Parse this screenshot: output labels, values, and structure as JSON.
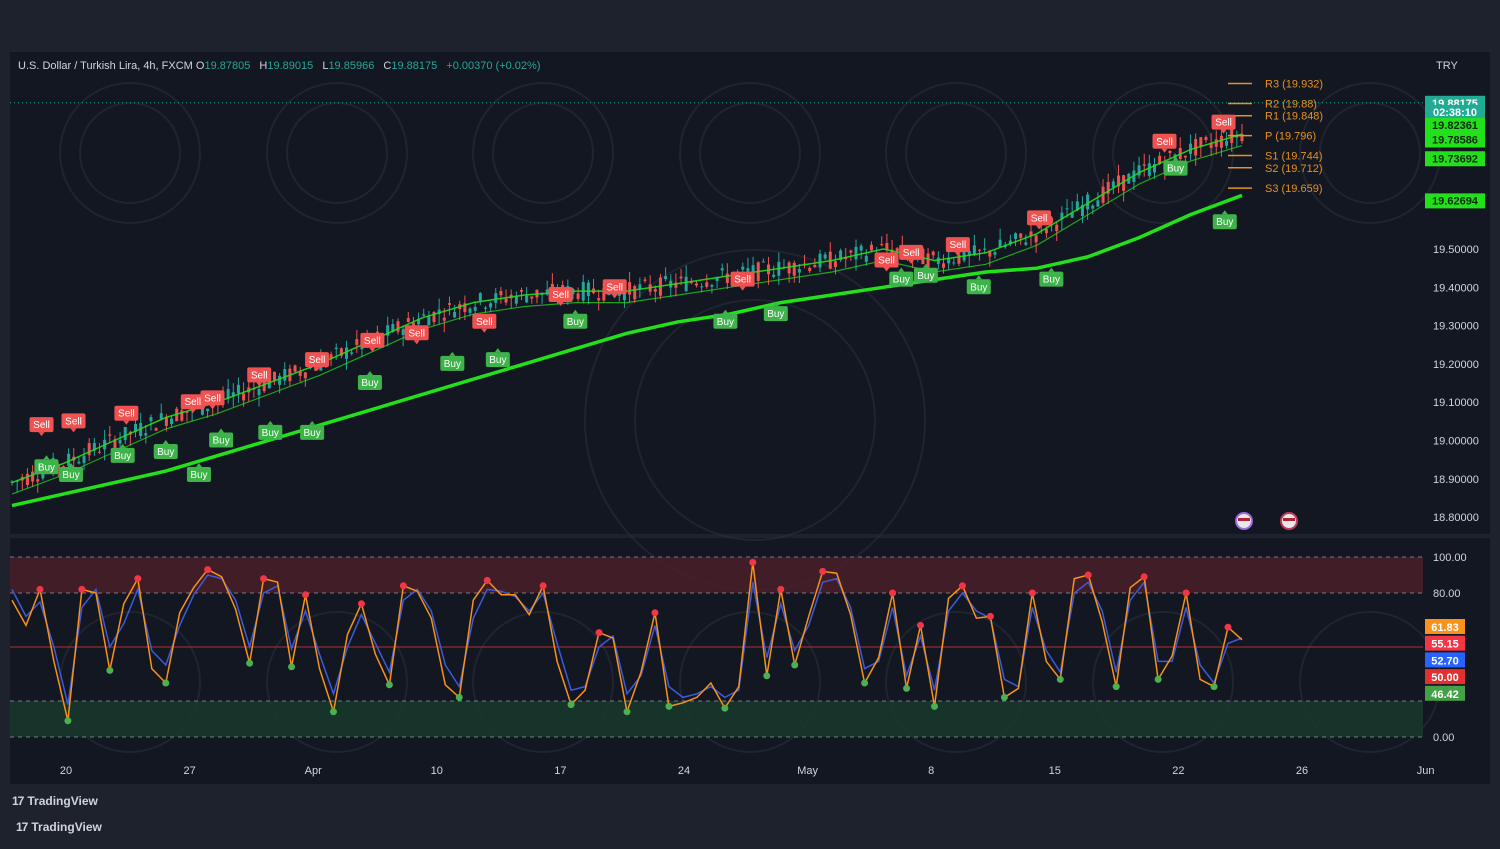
{
  "header": {
    "symbol": "U.S. Dollar / Turkish Lira, 4h, FXCM",
    "open_label": "O",
    "open": "19.87805",
    "high_label": "H",
    "high": "19.89015",
    "low_label": "L",
    "low": "19.85966",
    "close_label": "C",
    "close": "19.88175",
    "change": "+0.00370 (+0.02%)",
    "currency": "TRY"
  },
  "footer": {
    "brand1": "TradingView",
    "brand2": "TradingView"
  },
  "colors": {
    "bg": "#1e222d",
    "panel": "#131722",
    "up": "#26a69a",
    "down": "#ef5350",
    "ma": "#22e01a",
    "pivot": "#e8911b",
    "k": "#f7931a",
    "d": "#3b5bdb",
    "sell": "#f05252",
    "buy": "#3db34a"
  },
  "chart_data": [
    {
      "type": "line",
      "title": "U.S. Dollar / Turkish Lira, 4h, FXCM",
      "x_tick_labels": [
        "20",
        "27",
        "Apr",
        "10",
        "17",
        "24",
        "May",
        "8",
        "15",
        "22",
        "26",
        "Jun"
      ],
      "y_tick_labels": [
        "19.50000",
        "19.40000",
        "19.30000",
        "19.20000",
        "19.10000",
        "19.00000",
        "18.90000",
        "18.80000"
      ],
      "ylim": [
        18.77,
        20.0
      ],
      "grid": false,
      "series": [
        {
          "values": [
            18.83,
            18.86,
            18.89,
            18.92,
            18.96,
            19.0,
            19.04,
            19.08,
            19.12,
            19.16,
            19.2,
            19.24,
            19.28,
            19.31,
            19.33,
            19.36,
            19.38,
            19.4,
            19.42,
            19.44,
            19.45,
            19.48,
            19.53,
            19.59,
            19.64
          ]
        },
        {
          "values": [
            18.89,
            18.94,
            19.0,
            19.06,
            19.1,
            19.15,
            19.2,
            19.26,
            19.32,
            19.36,
            19.38,
            19.39,
            19.39,
            19.41,
            19.43,
            19.45,
            19.47,
            19.5,
            19.47,
            19.49,
            19.54,
            19.62,
            19.7,
            19.76,
            19.8
          ]
        }
      ],
      "pivots": [
        {
          "label": "R3 (19.932)",
          "value": 19.932
        },
        {
          "label": "R2 (19.88)",
          "value": 19.88
        },
        {
          "label": "R1 (19.848)",
          "value": 19.848
        },
        {
          "label": "P (19.796)",
          "value": 19.796
        },
        {
          "label": "S1 (19.744)",
          "value": 19.744
        },
        {
          "label": "S2 (19.712)",
          "value": 19.712
        },
        {
          "label": "S3 (19.659)",
          "value": 19.659
        }
      ],
      "price_badges": [
        {
          "text": "19.88175",
          "value": 19.88175,
          "color": "#22ab94"
        },
        {
          "text": "02:38:10",
          "value": 19.858,
          "color": "#22ab94"
        },
        {
          "text": "19.82361",
          "value": 19.82361,
          "color": "#22e01a"
        },
        {
          "text": "19.78586",
          "value": 19.78586,
          "color": "#22e01a"
        },
        {
          "text": "19.73692",
          "value": 19.73692,
          "color": "#22e01a"
        },
        {
          "text": "19.62694",
          "value": 19.62694,
          "color": "#22e01a"
        }
      ],
      "signals": [
        {
          "label": "Sell",
          "x": 0.024,
          "value": 19.04
        },
        {
          "label": "Sell",
          "x": 0.05,
          "value": 19.05
        },
        {
          "label": "Sell",
          "x": 0.093,
          "value": 19.07
        },
        {
          "label": "Sell",
          "x": 0.147,
          "value": 19.1
        },
        {
          "label": "Sell",
          "x": 0.163,
          "value": 19.11
        },
        {
          "label": "Sell",
          "x": 0.201,
          "value": 19.17
        },
        {
          "label": "Sell",
          "x": 0.248,
          "value": 19.21
        },
        {
          "label": "Sell",
          "x": 0.293,
          "value": 19.26
        },
        {
          "label": "Sell",
          "x": 0.329,
          "value": 19.28
        },
        {
          "label": "Sell",
          "x": 0.384,
          "value": 19.31
        },
        {
          "label": "Sell",
          "x": 0.446,
          "value": 19.38
        },
        {
          "label": "Sell",
          "x": 0.49,
          "value": 19.4
        },
        {
          "label": "Sell",
          "x": 0.594,
          "value": 19.42
        },
        {
          "label": "Sell",
          "x": 0.711,
          "value": 19.47
        },
        {
          "label": "Sell",
          "x": 0.731,
          "value": 19.49
        },
        {
          "label": "Sell",
          "x": 0.769,
          "value": 19.51
        },
        {
          "label": "Sell",
          "x": 0.835,
          "value": 19.58
        },
        {
          "label": "Sell",
          "x": 0.937,
          "value": 19.78
        },
        {
          "label": "Sell",
          "x": 0.985,
          "value": 19.83
        },
        {
          "label": "Buy",
          "x": 0.028,
          "value": 18.93
        },
        {
          "label": "Buy",
          "x": 0.048,
          "value": 18.91
        },
        {
          "label": "Buy",
          "x": 0.09,
          "value": 18.96
        },
        {
          "label": "Buy",
          "x": 0.125,
          "value": 18.97
        },
        {
          "label": "Buy",
          "x": 0.152,
          "value": 18.91
        },
        {
          "label": "Buy",
          "x": 0.17,
          "value": 19.0
        },
        {
          "label": "Buy",
          "x": 0.21,
          "value": 19.02
        },
        {
          "label": "Buy",
          "x": 0.244,
          "value": 19.02
        },
        {
          "label": "Buy",
          "x": 0.291,
          "value": 19.15
        },
        {
          "label": "Buy",
          "x": 0.358,
          "value": 19.2
        },
        {
          "label": "Buy",
          "x": 0.395,
          "value": 19.21
        },
        {
          "label": "Buy",
          "x": 0.458,
          "value": 19.31
        },
        {
          "label": "Buy",
          "x": 0.58,
          "value": 19.31
        },
        {
          "label": "Buy",
          "x": 0.621,
          "value": 19.33
        },
        {
          "label": "Buy",
          "x": 0.723,
          "value": 19.42
        },
        {
          "label": "Buy",
          "x": 0.743,
          "value": 19.43
        },
        {
          "label": "Buy",
          "x": 0.786,
          "value": 19.4
        },
        {
          "label": "Buy",
          "x": 0.845,
          "value": 19.42
        },
        {
          "label": "Buy",
          "x": 0.946,
          "value": 19.71
        },
        {
          "label": "Buy",
          "x": 0.986,
          "value": 19.57
        }
      ]
    },
    {
      "type": "line",
      "title": "",
      "y_tick_labels": [
        "100.00",
        "80.00",
        "0.00"
      ],
      "ylim": [
        0,
        100
      ],
      "bands": [
        {
          "from": 80,
          "to": 100,
          "color": "#4a1f28"
        },
        {
          "from": 0,
          "to": 20,
          "color": "#17392a"
        }
      ],
      "hlines": [
        100,
        80,
        50,
        20,
        0
      ],
      "series": [
        {
          "values": [
            76,
            62,
            82,
            42,
            9,
            82,
            80,
            37,
            74,
            88,
            38,
            30,
            69,
            83,
            93,
            89,
            71,
            41,
            88,
            86,
            39,
            79,
            38,
            14,
            57,
            74,
            46,
            29,
            84,
            81,
            66,
            29,
            22,
            76,
            87,
            79,
            79,
            68,
            84,
            42,
            18,
            26,
            58,
            55,
            14,
            36,
            69,
            17,
            19,
            22,
            30,
            16,
            28,
            97,
            34,
            82,
            40,
            67,
            92,
            91,
            68,
            30,
            44,
            80,
            27,
            62,
            17,
            77,
            84,
            66,
            67,
            22,
            27,
            80,
            42,
            32,
            88,
            90,
            64,
            28,
            83,
            89,
            32,
            45,
            80,
            32,
            28,
            61,
            54
          ]
        },
        {
          "values": [
            82,
            67,
            75,
            50,
            18,
            72,
            82,
            50,
            63,
            82,
            48,
            40,
            62,
            79,
            90,
            88,
            76,
            50,
            80,
            84,
            49,
            70,
            46,
            24,
            50,
            68,
            52,
            36,
            76,
            82,
            70,
            40,
            28,
            66,
            82,
            81,
            78,
            70,
            80,
            52,
            26,
            28,
            50,
            56,
            24,
            34,
            62,
            28,
            22,
            24,
            28,
            22,
            26,
            86,
            44,
            74,
            48,
            62,
            86,
            88,
            72,
            38,
            42,
            72,
            34,
            56,
            26,
            70,
            80,
            70,
            66,
            32,
            28,
            72,
            48,
            36,
            80,
            86,
            70,
            36,
            76,
            86,
            42,
            42,
            72,
            40,
            30,
            52,
            55
          ]
        }
      ],
      "value_badges": [
        {
          "text": "61.83",
          "value": 61.83,
          "color": "#f7931a"
        },
        {
          "text": "55.15",
          "value": 55.15,
          "color": "#f23645"
        },
        {
          "text": "52.70",
          "value": 52.7,
          "color": "#2962ff"
        },
        {
          "text": "50.00",
          "value": 50.0,
          "color": "#e03030"
        },
        {
          "text": "46.42",
          "value": 46.42,
          "color": "#43a047"
        }
      ]
    }
  ]
}
